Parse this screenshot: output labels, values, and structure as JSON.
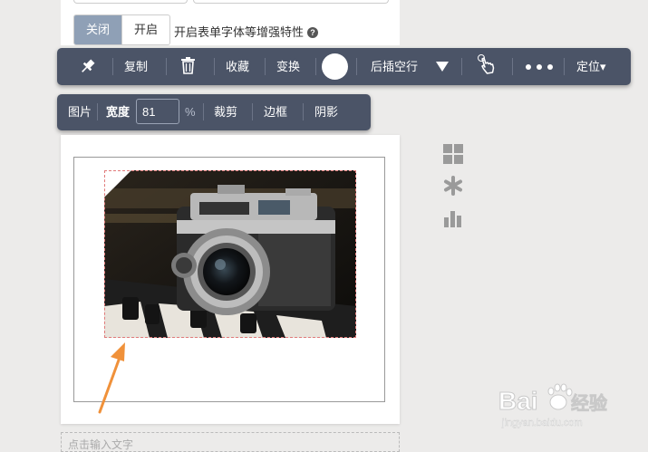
{
  "settings": {
    "toggle_off": "关闭",
    "toggle_on": "开启",
    "description": "开启表单字体等增强特性",
    "help_glyph": "?"
  },
  "toolbar": {
    "copy": "复制",
    "favorite": "收藏",
    "transform": "变换",
    "insert_blank_after": "后插空行",
    "position": "定位▾",
    "icons": [
      "pin-icon",
      "trash-icon",
      "color-circle",
      "triangle-down-icon",
      "pointer-hand-icon",
      "more-dots-icon"
    ]
  },
  "image_toolbar": {
    "label": "图片",
    "width_label": "宽度",
    "width_value": "81",
    "width_unit": "%",
    "crop": "裁剪",
    "border": "边框",
    "shadow": "阴影"
  },
  "editor": {
    "text_placeholder": "点击输入文字"
  },
  "side_icons": [
    "grid-icon",
    "asterisk-icon",
    "bar-chart-icon"
  ],
  "colors": {
    "toolbar_bg": "#4b5467",
    "toggle_active": "#8fa0b6",
    "arrow": "#f0913a",
    "dashed_selection": "#e07a7a"
  },
  "watermark": {
    "brand": "Bai",
    "brand2": "经验",
    "url": "jingyan.baidu.com"
  }
}
